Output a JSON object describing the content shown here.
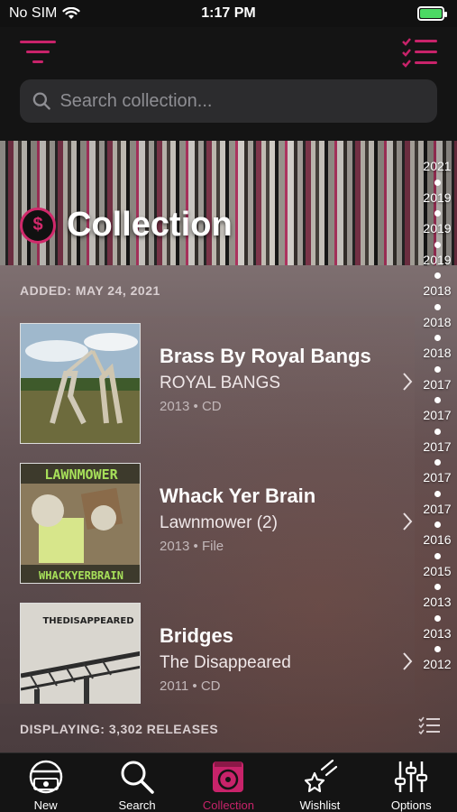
{
  "status_bar": {
    "carrier": "No SIM",
    "time": "1:17 PM"
  },
  "header": {
    "search_placeholder": "Search collection..."
  },
  "hero": {
    "title": "Collection"
  },
  "list": {
    "section_label": "ADDED: MAY 24, 2021",
    "releases": [
      {
        "title": "Brass By Royal Bangs",
        "artist": "ROYAL BANGS",
        "meta": "2013 • CD"
      },
      {
        "title": "Whack Yer Brain",
        "artist": "Lawnmower (2)",
        "meta": "2013 • File"
      },
      {
        "title": "Bridges",
        "artist": "The Disappeared",
        "meta": "2011 • CD"
      }
    ],
    "footer_label": "DISPLAYING: 3,302 RELEASES"
  },
  "year_index": [
    "2021",
    "2019",
    "2019",
    "2019",
    "2018",
    "2018",
    "2018",
    "2017",
    "2017",
    "2017",
    "2017",
    "2017",
    "2016",
    "2015",
    "2013",
    "2013",
    "2012"
  ],
  "tab_bar": {
    "tabs": [
      {
        "label": "New"
      },
      {
        "label": "Search"
      },
      {
        "label": "Collection"
      },
      {
        "label": "Wishlist"
      },
      {
        "label": "Options"
      }
    ]
  },
  "colors": {
    "accent": "#c8236a",
    "background": "#141414"
  }
}
